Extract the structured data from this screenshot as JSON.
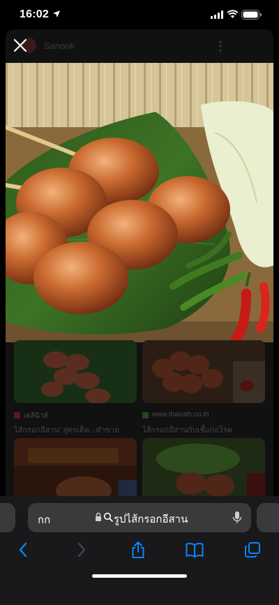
{
  "status_bar": {
    "time": "16:02",
    "icons": [
      "location-arrow-icon",
      "cellular-signal-icon",
      "wifi-icon",
      "battery-icon"
    ]
  },
  "image_viewer": {
    "site_name": "Sanook",
    "icons": [
      "close-icon",
      "more-options-icon"
    ],
    "results": [
      {
        "source": "เดลินิวส์",
        "title": "ไส้กรอกอีสาน' สูตรเด็ด...ทำขาย"
      },
      {
        "source": "www.thairath.co.th",
        "title": "ไส้กรอกอีสานกับเชื้อก่อโรค"
      }
    ]
  },
  "browser": {
    "aa_label": "กก",
    "address": "รูปไส้กรอกอีสาน",
    "toolbar": [
      "back-icon",
      "forward-icon",
      "share-icon",
      "bookmarks-icon",
      "tabs-icon"
    ]
  },
  "colors": {
    "accent": "#0a84ff",
    "toolbar_bg": "#1c1c1e",
    "pill_bg": "#3a3a3c"
  }
}
